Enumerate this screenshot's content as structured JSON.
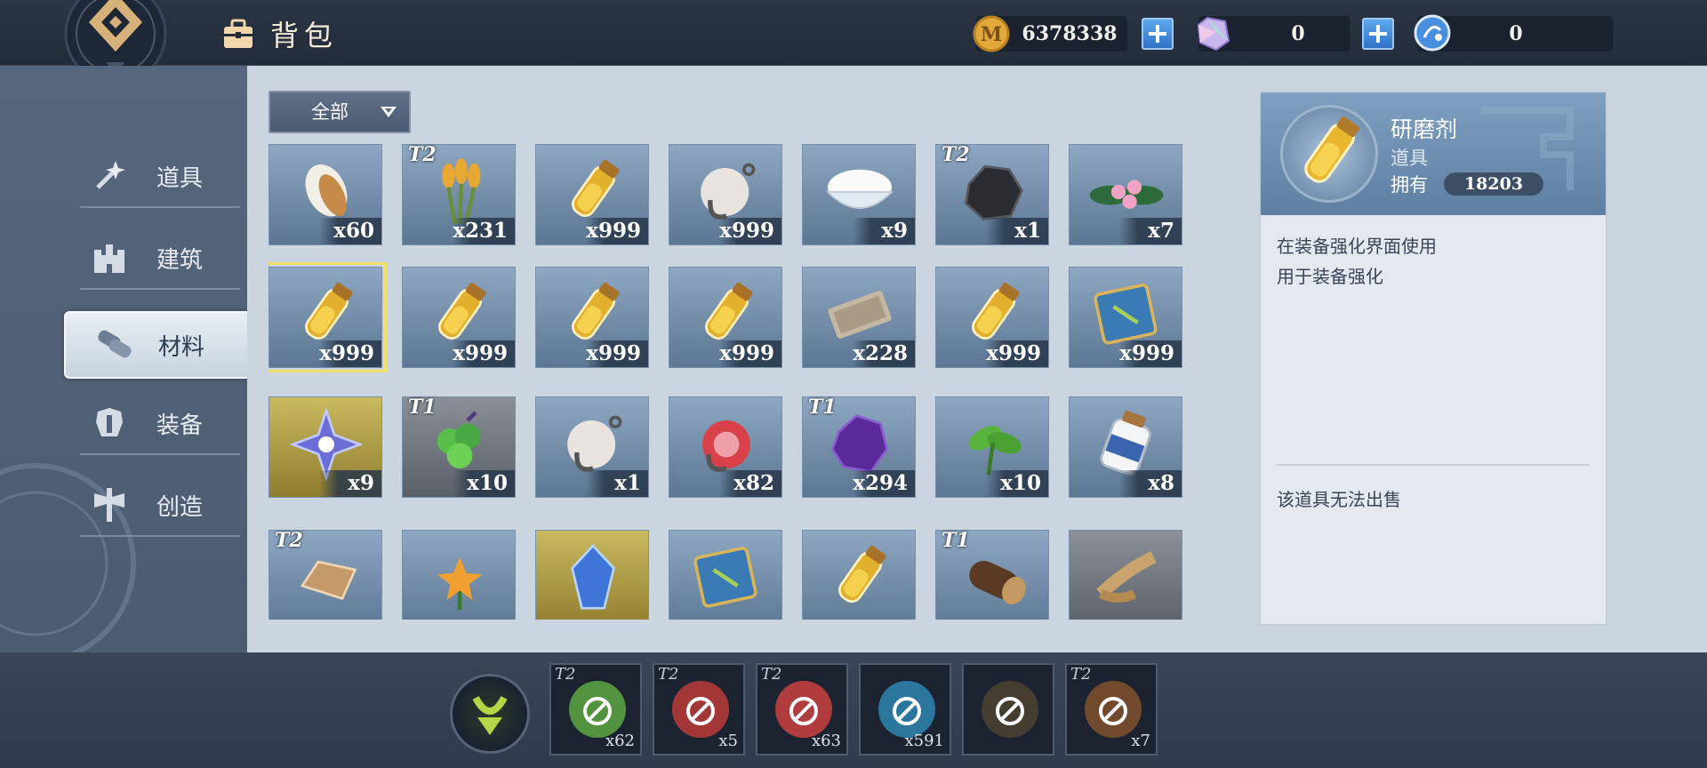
{
  "header": {
    "title": "背包",
    "currencies": [
      {
        "name": "gold-coin",
        "value": "6378338"
      },
      {
        "name": "crystal",
        "value": "0"
      },
      {
        "name": "blue-orb",
        "value": "0"
      }
    ]
  },
  "sidebar": {
    "items": [
      {
        "label": "道具",
        "icon": "sparkle-wand-icon"
      },
      {
        "label": "建筑",
        "icon": "castle-icon"
      },
      {
        "label": "材料",
        "icon": "materials-icon",
        "active": true
      },
      {
        "label": "装备",
        "icon": "armor-icon"
      },
      {
        "label": "创造",
        "icon": "anvil-icon"
      }
    ]
  },
  "filter": {
    "label": "全部"
  },
  "grid": {
    "rows": [
      [
        {
          "icon": "seed-icon",
          "count": "x60",
          "tier": ""
        },
        {
          "icon": "wheat-icon",
          "count": "x231",
          "tier": "T2"
        },
        {
          "icon": "potion-vial-icon",
          "count": "x999",
          "tier": ""
        },
        {
          "icon": "wool-hook-icon",
          "count": "x999",
          "tier": ""
        },
        {
          "icon": "salt-bowl-icon",
          "count": "x9",
          "tier": ""
        },
        {
          "icon": "coal-icon",
          "count": "x1",
          "tier": "T2"
        },
        {
          "icon": "pink-flower-icon",
          "count": "x7",
          "tier": ""
        }
      ],
      [
        {
          "icon": "potion-vial-icon",
          "count": "x999",
          "tier": "",
          "selected": true
        },
        {
          "icon": "potion-vial-icon",
          "count": "x999",
          "tier": ""
        },
        {
          "icon": "potion-vial-icon",
          "count": "x999",
          "tier": ""
        },
        {
          "icon": "potion-vial-icon",
          "count": "x999",
          "tier": ""
        },
        {
          "icon": "ticket-icon",
          "count": "x228",
          "tier": ""
        },
        {
          "icon": "potion-vial-icon",
          "count": "x999",
          "tier": ""
        },
        {
          "icon": "blue-book-icon",
          "count": "x999",
          "tier": ""
        }
      ],
      [
        {
          "icon": "snowflake-crystal-icon",
          "count": "x9",
          "tier": "",
          "bg": "gold"
        },
        {
          "icon": "green-fruit-icon",
          "count": "x10",
          "tier": "T1",
          "bg": "gray"
        },
        {
          "icon": "wool-hook-icon",
          "count": "x1",
          "tier": ""
        },
        {
          "icon": "meat-hook-icon",
          "count": "x82",
          "tier": ""
        },
        {
          "icon": "purple-ore-icon",
          "count": "x294",
          "tier": "T1"
        },
        {
          "icon": "green-leaf-icon",
          "count": "x10",
          "tier": ""
        },
        {
          "icon": "milk-jar-icon",
          "count": "x8",
          "tier": ""
        }
      ],
      [
        {
          "icon": "ingot-icon",
          "count": "",
          "tier": "T2"
        },
        {
          "icon": "lily-icon",
          "count": "",
          "tier": ""
        },
        {
          "icon": "blue-gem-icon",
          "count": "",
          "tier": "",
          "bg": "gold"
        },
        {
          "icon": "blue-book-icon",
          "count": "",
          "tier": ""
        },
        {
          "icon": "potion-vial-icon",
          "count": "",
          "tier": ""
        },
        {
          "icon": "log-icon",
          "count": "",
          "tier": "T1"
        },
        {
          "icon": "rope-icon",
          "count": "",
          "tier": "",
          "bg": "gray"
        }
      ]
    ]
  },
  "detail": {
    "name": "研磨剂",
    "type": "道具",
    "own_label": "拥有",
    "own_value": "18203",
    "desc_line1": "在装备强化界面使用",
    "desc_line2": "用于装备强化",
    "note": "该道具无法出售"
  },
  "quickbar": {
    "slots": [
      {
        "icon": "green-potion-icon",
        "count": "x62",
        "tier": "T2",
        "color": "#5aa043"
      },
      {
        "icon": "red-potion-icon",
        "count": "x5",
        "tier": "T2",
        "color": "#b33a3a"
      },
      {
        "icon": "red-potion-icon",
        "count": "x63",
        "tier": "T2",
        "color": "#c13f3f"
      },
      {
        "icon": "blue-hex-icon",
        "count": "x591",
        "tier": "",
        "color": "#2d7fa8"
      },
      {
        "icon": "dark-hex-icon",
        "count": "",
        "tier": "",
        "color": "#4b4032"
      },
      {
        "icon": "barrel-icon",
        "count": "x7",
        "tier": "T2",
        "color": "#7b4f2e"
      }
    ]
  }
}
